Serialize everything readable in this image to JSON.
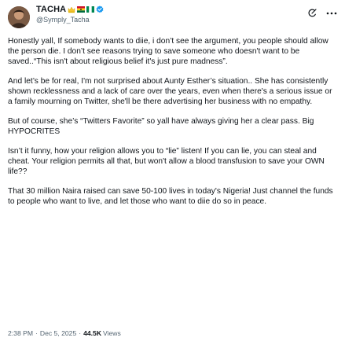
{
  "author": {
    "name": "TACHA",
    "handle": "@Symply_Tacha"
  },
  "tweet": {
    "paragraphs": [
      "Honestly yall, If somebody wants to diie, i don’t see the argument, you people should allow the person die. I don’t see reasons trying to save someone who doesn't want to be saved..“This isn't about religious belief it's just pure madness”.",
      "And let’s be for real, I'm not surprised about Aunty Esther’s situation.. She has consistently shown recklessness and a lack of care over the years, even when there's a serious issue or a family mourning on Twitter, she'll be there advertising her business with no empathy.",
      "But of course, she’s “Twitters Favorite” so yall have always giving her a clear pass. Big HYPOCRITES",
      "Isn’t it funny, how your religion allows you to “lie” listen! If you can lie, you can steal and cheat. Your religion permits all that, but won't allow a blood transfusion to save your OWN life??",
      "That 30 million Naira raised can save 50-100 lives in today's Nigeria! Just channel the funds to people who want to live, and let those who want to diie do so in peace."
    ]
  },
  "meta": {
    "time": "2:38 PM",
    "separator": "·",
    "date": "Dec 5, 2025",
    "views_count": "44.5K",
    "views_label": "Views"
  },
  "icons": {
    "avatar": "avatar",
    "flags": [
      "crown-icon",
      "ghana-flag-icon",
      "nigeria-flag-icon"
    ],
    "verified": "verified-badge-icon",
    "grok": "grok-icon",
    "more": "more-icon"
  },
  "colors": {
    "text": "#0f1419",
    "secondary": "#536471",
    "verified": "#1d9bf0"
  }
}
